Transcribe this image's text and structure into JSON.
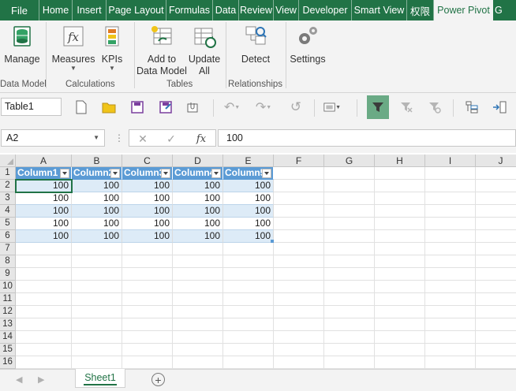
{
  "ribbon_tabs": [
    {
      "label": "File"
    },
    {
      "label": "Home"
    },
    {
      "label": "Insert"
    },
    {
      "label": "Page Layout"
    },
    {
      "label": "Formulas"
    },
    {
      "label": "Data"
    },
    {
      "label": "Review"
    },
    {
      "label": "View"
    },
    {
      "label": "Developer"
    },
    {
      "label": "Smart View"
    },
    {
      "label": "权限"
    },
    {
      "label": "Power Pivot",
      "active": true
    },
    {
      "label": "G"
    }
  ],
  "ribbon": {
    "manage": {
      "label": "Manage",
      "group": "Data Model"
    },
    "measures": {
      "label": "Measures"
    },
    "kpis": {
      "label": "KPIs"
    },
    "calc_group": "Calculations",
    "add_to_dm": {
      "line1": "Add to",
      "line2": "Data Model"
    },
    "update_all": {
      "line1": "Update",
      "line2": "All"
    },
    "tables_group": "Tables",
    "detect": {
      "label": "Detect"
    },
    "relationships_group": "Relationships",
    "settings": {
      "label": "Settings"
    }
  },
  "toolbar": {
    "table_name": "Table1"
  },
  "formula_bar": {
    "name_box": "A2",
    "fx": "fx",
    "value": "100"
  },
  "columns": [
    "A",
    "B",
    "C",
    "D",
    "E",
    "F",
    "G",
    "H",
    "I",
    "J"
  ],
  "rows": [
    "1",
    "2",
    "3",
    "4",
    "5",
    "6",
    "7",
    "8",
    "9",
    "10",
    "11",
    "12",
    "13",
    "14",
    "15",
    "16"
  ],
  "table": {
    "headers": [
      "Column1",
      "Column2",
      "Column3",
      "Column4",
      "Column5"
    ],
    "data": [
      [
        "100",
        "100",
        "100",
        "100",
        "100"
      ],
      [
        "100",
        "100",
        "100",
        "100",
        "100"
      ],
      [
        "100",
        "100",
        "100",
        "100",
        "100"
      ],
      [
        "100",
        "100",
        "100",
        "100",
        "100"
      ],
      [
        "100",
        "100",
        "100",
        "100",
        "100"
      ]
    ]
  },
  "sheets": {
    "active": "Sheet1",
    "add": "+"
  },
  "colors": {
    "excel_green": "#217346",
    "table_header": "#5b9bd5",
    "band": "#ddebf7"
  }
}
